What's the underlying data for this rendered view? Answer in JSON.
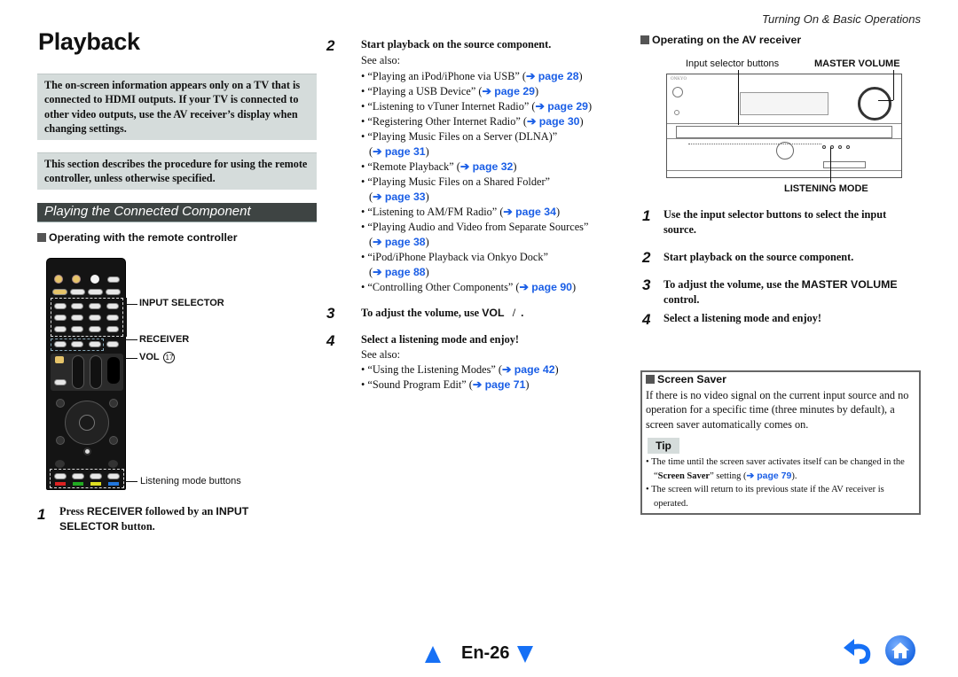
{
  "header": {
    "running_head": "Turning On & Basic Operations",
    "title": "Playback"
  },
  "notes": {
    "hdmi": "The on-screen information appears only on a TV that is connected to HDMI outputs. If your TV is connected to other video outputs, use the AV receiver’s display when changing settings.",
    "remote": "This section describes the procedure for using the remote controller, unless otherwise specified."
  },
  "section": {
    "title": "Playing the Connected Component"
  },
  "remote_section": {
    "subhead": "Operating with the remote controller",
    "callouts": {
      "input_selector": "INPUT SELECTOR",
      "receiver": "RECEIVER",
      "vol": "VOL",
      "vol_badge": "17",
      "listening_mode": "Listening mode buttons"
    },
    "step1": {
      "num": "1",
      "text_a": "Press ",
      "kw1": "RECEIVER",
      "text_b": " followed by an ",
      "kw2": "INPUT SELECTOR",
      "text_c": " button."
    }
  },
  "middle": {
    "step2": {
      "num": "2",
      "text": "Start playback on the source component.",
      "see_also": "See also:",
      "links": [
        {
          "text": "“Playing an iPod/iPhone via USB” (",
          "link": "➔ page 28",
          "close": ")"
        },
        {
          "text": "“Playing a USB Device” (",
          "link": "➔ page 29",
          "close": ")"
        },
        {
          "text": "“Listening to vTuner Internet Radio” (",
          "link": "➔ page 29",
          "close": ")"
        },
        {
          "text": "“Registering Other Internet Radio” (",
          "link": "➔ page 30",
          "close": ")"
        },
        {
          "text": "“Playing Music Files on a Server (DLNA)”",
          "text2": "(",
          "link": "➔ page 31",
          "close": ")"
        },
        {
          "text": "“Remote Playback” (",
          "link": "➔ page 32",
          "close": ")"
        },
        {
          "text": "“Playing Music Files on a Shared Folder”",
          "text2": "(",
          "link": "➔ page 33",
          "close": ")"
        },
        {
          "text": "“Listening to AM/FM Radio” (",
          "link": "➔ page 34",
          "close": ")"
        },
        {
          "text": "“Playing Audio and Video from Separate Sources”",
          "text2": "(",
          "link": "➔ page 38",
          "close": ")"
        },
        {
          "text": "“iPod/iPhone Playback via Onkyo Dock”",
          "text2": "(",
          "link": "➔ page 88",
          "close": ")"
        },
        {
          "text": "“Controlling Other Components” (",
          "link": "➔ page 90",
          "close": ")"
        }
      ]
    },
    "step3": {
      "num": "3",
      "text_a": "To adjust the volume, use ",
      "kw": "VOL",
      "text_b": "   /  ."
    },
    "step4": {
      "num": "4",
      "text": "Select a listening mode and enjoy!",
      "see_also": "See also:",
      "links": [
        {
          "text": "“Using the Listening Modes” (",
          "link": "➔ page 42",
          "close": ")"
        },
        {
          "text": "“Sound Program Edit” (",
          "link": "➔ page 71",
          "close": ")"
        }
      ]
    }
  },
  "receiver_section": {
    "subhead": "Operating on the AV receiver",
    "callouts": {
      "input_selector_buttons": "Input selector buttons",
      "master_volume": "MASTER VOLUME",
      "listening_mode": "LISTENING MODE",
      "brand": "ONKYO"
    },
    "steps": [
      {
        "num": "1",
        "text": "Use the input selector buttons to select the input source."
      },
      {
        "num": "2",
        "text": "Start playback on the source component."
      },
      {
        "num": "3",
        "text_a": "To adjust the volume, use the ",
        "kw": "MASTER VOLUME",
        "text_b": " control."
      },
      {
        "num": "4",
        "text": "Select a listening mode and enjoy!"
      }
    ]
  },
  "screen_saver": {
    "subhead": "Screen Saver",
    "body": "If there is no video signal on the current input source and no operation for a specific time (three minutes by default), a screen saver automatically comes on.",
    "tip_label": "Tip",
    "tips": [
      {
        "a": "The time until the screen saver activates itself can be changed in the “",
        "b": "Screen Saver",
        "c": "” setting (",
        "link": "➔ page 79",
        "d": ")."
      },
      {
        "a": "The screen will return to its previous state if the AV receiver is operated."
      }
    ]
  },
  "footer": {
    "page_label": "En-26",
    "colors": {
      "nav": "#1670f5",
      "link": "#1a5ee6"
    }
  }
}
